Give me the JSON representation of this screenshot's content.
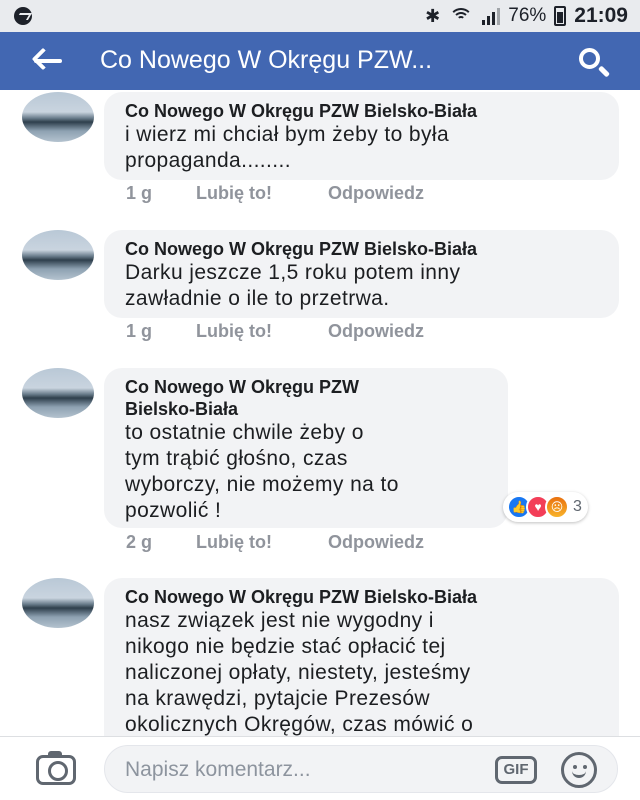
{
  "status_bar": {
    "battery": "76%",
    "time": "21:09",
    "icons": [
      "messenger-icon",
      "bluetooth-icon",
      "wifi-icon",
      "signal-icon",
      "battery-icon"
    ]
  },
  "header": {
    "title": "Co Nowego W Okręgu PZW...",
    "icons": [
      "back-arrow-icon",
      "search-icon"
    ],
    "background": "#4267b2"
  },
  "comments": [
    {
      "author": "Co Nowego W Okręgu PZW Bielsko-Biała",
      "lines": [
        "i wierz mi chciał bym żeby to była",
        "propaganda........"
      ],
      "time": "1 g",
      "like": "Lubię to!",
      "reply": "Odpowiedz"
    },
    {
      "author": "Co Nowego W Okręgu PZW Bielsko-Biała",
      "lines": [
        "Darku jeszcze 1,5 roku potem inny",
        "zawładnie o ile to przetrwa."
      ],
      "time": "1 g",
      "like": "Lubię to!",
      "reply": "Odpowiedz"
    },
    {
      "author_lines": [
        "Co Nowego W Okręgu PZW",
        "Bielsko-Biała"
      ],
      "lines": [
        "to ostatnie chwile żeby o",
        "tym trąbić głośno, czas",
        "wyborczy, nie możemy na to",
        "pozwolić !"
      ],
      "time": "2 g",
      "like": "Lubię to!",
      "reply": "Odpowiedz",
      "reactions": {
        "types": [
          "like",
          "love",
          "angry"
        ],
        "count": "3"
      }
    },
    {
      "author": "Co Nowego W Okręgu PZW Bielsko-Biała",
      "lines": [
        "nasz związek jest nie wygodny i",
        "nikogo nie będzie stać opłacić tej",
        "naliczonej  opłaty, niestety, jesteśmy",
        "na krawędzi, pytajcie Prezesów",
        "okolicznych Okręgów, czas mówić o"
      ]
    }
  ],
  "composer": {
    "placeholder": "Napisz komentarz...",
    "gif_label": "GIF",
    "icons": [
      "camera-icon",
      "gif-icon",
      "emoji-icon"
    ]
  }
}
